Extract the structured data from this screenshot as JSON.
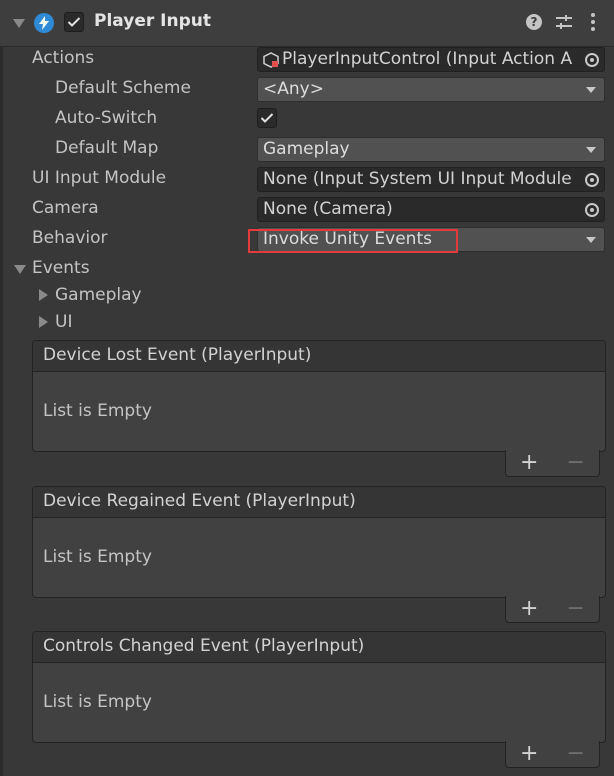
{
  "component": {
    "title": "Player Input",
    "help_icon": "help-icon",
    "presets_icon": "presets-icon",
    "menu_icon": "kebab-menu-icon"
  },
  "properties": {
    "actions": {
      "label": "Actions",
      "value": "PlayerInputControl (Input Action A"
    },
    "default_scheme": {
      "label": "Default Scheme",
      "value": "<Any>"
    },
    "auto_switch": {
      "label": "Auto-Switch",
      "checked": true
    },
    "default_map": {
      "label": "Default Map",
      "value": "Gameplay"
    },
    "ui_input_module": {
      "label": "UI Input Module",
      "value": "None (Input System UI Input Module"
    },
    "camera": {
      "label": "Camera",
      "value": "None (Camera)"
    },
    "behavior": {
      "label": "Behavior",
      "value": "Invoke Unity Events"
    }
  },
  "events": {
    "label": "Events",
    "groups": [
      "Gameplay",
      "UI"
    ],
    "lists": [
      {
        "title": "Device Lost Event (PlayerInput)",
        "body": "List is Empty"
      },
      {
        "title": "Device Regained Event (PlayerInput)",
        "body": "List is Empty"
      },
      {
        "title": "Controls Changed Event (PlayerInput)",
        "body": "List is Empty"
      }
    ],
    "add_symbol": "+",
    "remove_symbol": "−"
  },
  "colors": {
    "highlight": "#e53a3a",
    "component_icon": "#2f8ad6"
  }
}
